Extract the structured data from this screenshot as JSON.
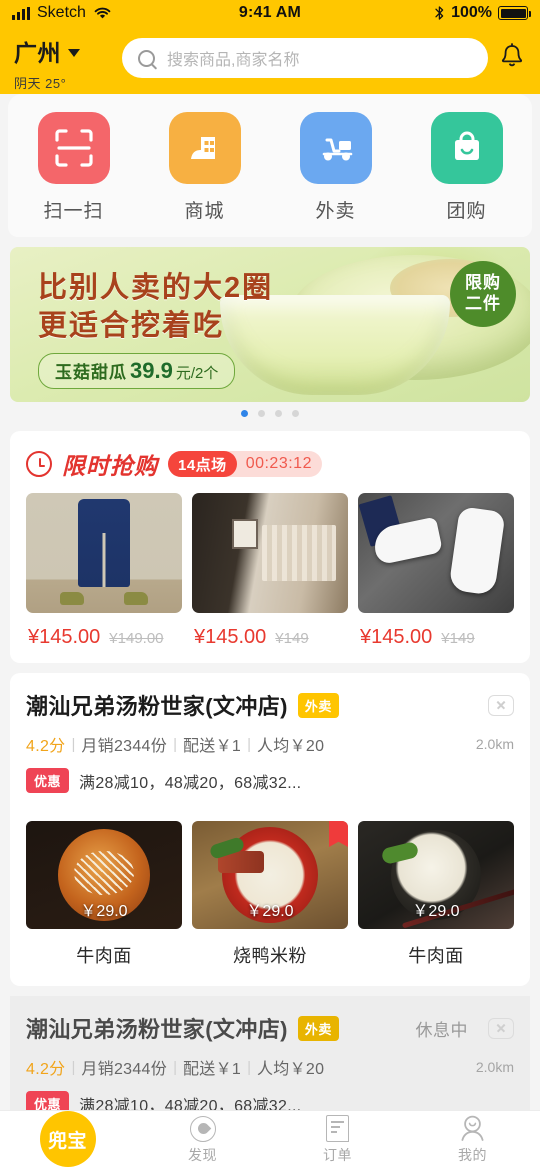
{
  "status_bar": {
    "carrier": "Sketch",
    "time": "9:41 AM",
    "battery_percent": "100%",
    "signal_icon": "signal-bars-icon",
    "wifi_icon": "wifi-icon",
    "bluetooth_icon": "bluetooth-icon",
    "battery_icon": "battery-full-icon"
  },
  "header": {
    "city": "广州",
    "weather": "阴天 25°",
    "chevron_icon": "chevron-down-icon",
    "search_placeholder": "搜索商品,商家名称",
    "search_value": "",
    "search_icon": "search-icon",
    "bell_icon": "bell-icon",
    "background_color": "#FFC700"
  },
  "categories": [
    {
      "label": "扫一扫",
      "icon": "scan-icon",
      "color": "#F4666A"
    },
    {
      "label": "商城",
      "icon": "mall-icon",
      "color": "#F7B042"
    },
    {
      "label": "外卖",
      "icon": "delivery-icon",
      "color": "#6BA8F0"
    },
    {
      "label": "团购",
      "icon": "groupbuy-icon",
      "color": "#35C69B"
    }
  ],
  "banner": {
    "headline_line1": "比别人卖的大2圈",
    "headline_line2": "更适合挖着吃",
    "product_name": "玉菇甜瓜",
    "price_number": "39.9",
    "price_unit": "元/2个",
    "limit_line1": "限购",
    "limit_line2": "二件",
    "dots_total": 4,
    "active_dot": 0,
    "headline_color": "#A8421C",
    "badge_color": "#4E8C2A"
  },
  "flash_sale": {
    "title": "限时抢购",
    "clock_icon": "clock-icon",
    "session_badge": "14点场",
    "countdown": "00:23:12",
    "accent_color": "#E3342F",
    "items": [
      {
        "image": "navy-cargo-pants-photo",
        "price": "¥145.00",
        "original_price": "¥149.00"
      },
      {
        "image": "walk-in-closet-photo",
        "price": "¥145.00",
        "original_price": "¥149"
      },
      {
        "image": "white-sneakers-photo",
        "price": "¥145.00",
        "original_price": "¥149"
      }
    ]
  },
  "shops": [
    {
      "name": "潮汕兄弟汤粉世家(文冲店)",
      "tag": "外卖",
      "status": "",
      "close_icon": "close-icon",
      "rating": "4.2分",
      "monthly_sales": "月销2344份",
      "delivery_fee": "配送￥1",
      "avg_price": "人均￥20",
      "distance": "2.0km",
      "promo_tag": "优惠",
      "promo_text": "满28减10，48减20，68减32...",
      "closed": false,
      "dishes": [
        {
          "name": "牛肉面",
          "price": "￥29.0",
          "image": "beef-noodle-soup-photo",
          "badge": false
        },
        {
          "name": "烧鸭米粉",
          "price": "￥29.0",
          "image": "roast-duck-noodle-photo",
          "badge": true
        },
        {
          "name": "牛肉面",
          "price": "￥29.0",
          "image": "rice-noodle-bowl-photo",
          "badge": false
        }
      ]
    },
    {
      "name": "潮汕兄弟汤粉世家(文冲店)",
      "tag": "外卖",
      "status": "休息中",
      "close_icon": "close-icon",
      "rating": "4.2分",
      "monthly_sales": "月销2344份",
      "delivery_fee": "配送￥1",
      "avg_price": "人均￥20",
      "distance": "2.0km",
      "promo_tag": "优惠",
      "promo_text": "满28减10，48减20，68减32...",
      "closed": true,
      "dishes": []
    }
  ],
  "tabbar": {
    "logo_text": "兜宝",
    "items": [
      {
        "label": "",
        "icon": "app-logo-icon"
      },
      {
        "label": "发现",
        "icon": "compass-icon"
      },
      {
        "label": "订单",
        "icon": "order-doc-icon"
      },
      {
        "label": "我的",
        "icon": "user-icon"
      }
    ]
  },
  "separator": "|"
}
